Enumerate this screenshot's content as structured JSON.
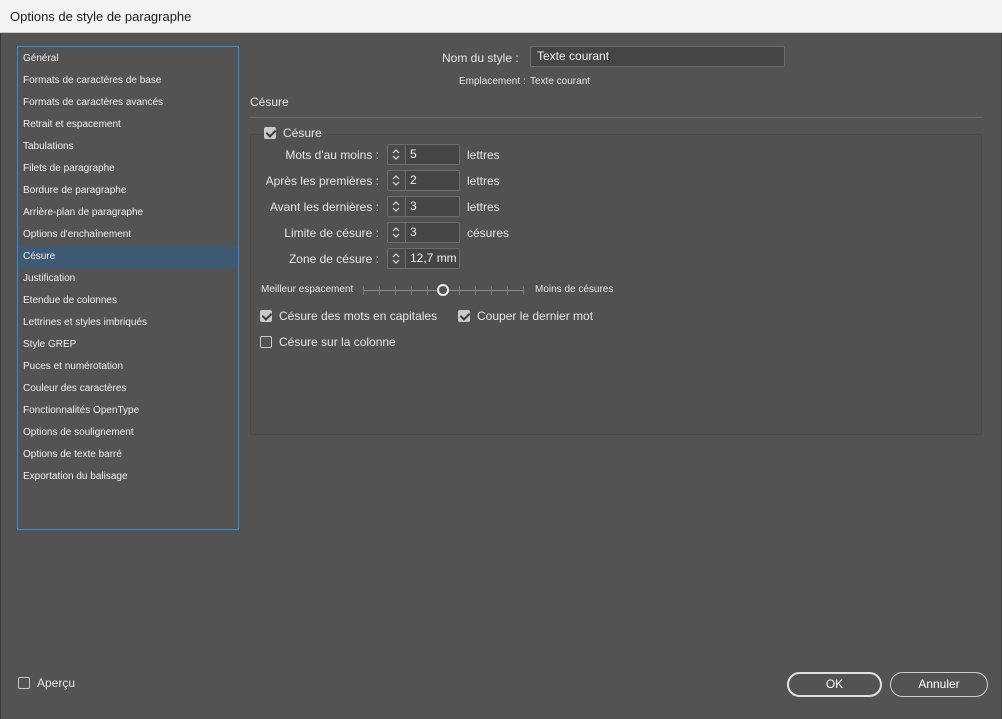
{
  "window": {
    "title": "Options de style de paragraphe"
  },
  "sidebar": {
    "items": [
      "Général",
      "Formats de caractères de base",
      "Formats de caractères avancés",
      "Retrait et espacement",
      "Tabulations",
      "Filets de paragraphe",
      "Bordure de paragraphe",
      "Arrière-plan de paragraphe",
      "Options d'enchaînement",
      "Césure",
      "Justification",
      "Etendue de colonnes",
      "Lettrines et styles imbriqués",
      "Style GREP",
      "Puces et numérotation",
      "Couleur des caractères",
      "Fonctionnalités OpenType",
      "Options de soulignement",
      "Options de texte barré",
      "Exportation du balisage"
    ],
    "selected_index": 9
  },
  "header": {
    "style_name_label": "Nom du style :",
    "style_name_value": "Texte courant",
    "location_label": "Emplacement :",
    "location_value": "Texte courant"
  },
  "section": {
    "title": "Césure",
    "hyphenation_checkbox": {
      "label": "Césure",
      "checked": true
    },
    "fields": [
      {
        "label": "Mots d'au moins :",
        "value": "5",
        "unit": "lettres"
      },
      {
        "label": "Après les premières :",
        "value": "2",
        "unit": "lettres"
      },
      {
        "label": "Avant les dernières :",
        "value": "3",
        "unit": "lettres"
      },
      {
        "label": "Limite de césure :",
        "value": "3",
        "unit": "césures"
      },
      {
        "label": "Zone de césure :",
        "value": "12,7 mm",
        "unit": ""
      }
    ],
    "slider": {
      "left_label": "Meilleur espacement",
      "right_label": "Moins de césures",
      "value_fraction": 0.5,
      "ticks": 11
    },
    "options": {
      "capitalized": {
        "label": "Césure des mots en capitales",
        "checked": true
      },
      "last_word": {
        "label": "Couper le dernier mot",
        "checked": true
      },
      "across_column": {
        "label": "Césure sur la colonne",
        "checked": false
      }
    }
  },
  "footer": {
    "preview": {
      "label": "Aperçu",
      "checked": false
    },
    "ok_label": "OK",
    "cancel_label": "Annuler"
  }
}
